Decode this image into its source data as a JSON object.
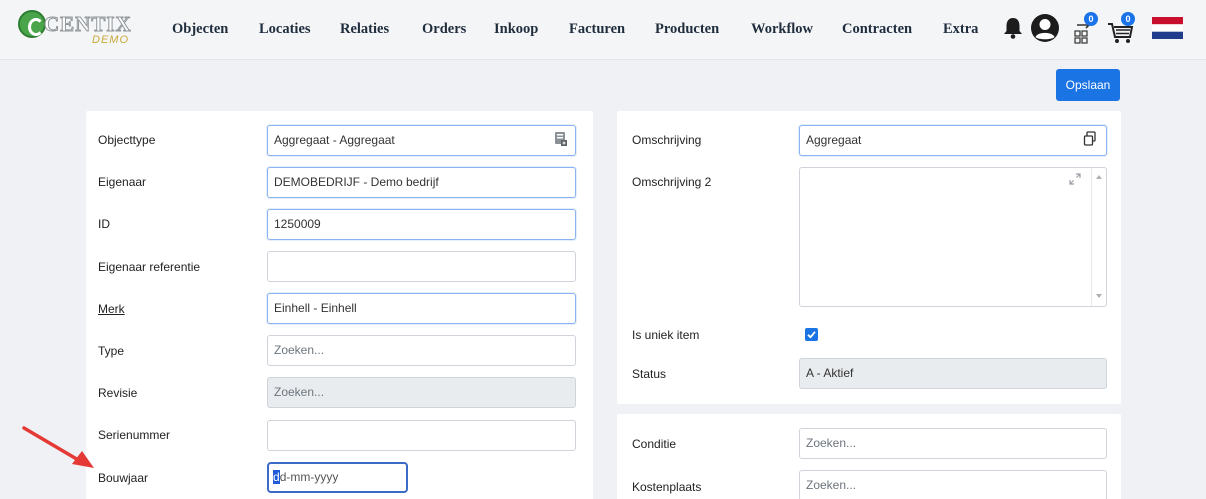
{
  "app": {
    "logo_text": "CENTIX",
    "logo_sub": "DEMO"
  },
  "nav": {
    "items": [
      "Objecten",
      "Locaties",
      "Relaties",
      "Orders",
      "Inkoop",
      "Facturen",
      "Producten",
      "Workflow",
      "Contracten",
      "Extra"
    ],
    "scan_badge": "0",
    "cart_badge": "0"
  },
  "toolbar": {
    "save_label": "Opslaan"
  },
  "left": {
    "objecttype": {
      "label": "Objecttype",
      "value": "Aggregaat - Aggregaat"
    },
    "eigenaar": {
      "label": "Eigenaar",
      "value": "DEMOBEDRIJF - Demo bedrijf"
    },
    "id": {
      "label": "ID",
      "value": "1250009"
    },
    "eigenaar_ref": {
      "label": "Eigenaar referentie",
      "value": ""
    },
    "merk": {
      "label": "Merk",
      "value": "Einhell - Einhell"
    },
    "type": {
      "label": "Type",
      "placeholder": "Zoeken..."
    },
    "revisie": {
      "label": "Revisie",
      "placeholder": "Zoeken..."
    },
    "serienummer": {
      "label": "Serienummer",
      "value": ""
    },
    "bouwjaar": {
      "label": "Bouwjaar",
      "placeholder_first": "d",
      "placeholder_rest": "d-mm-yyyy"
    }
  },
  "right": {
    "omschrijving": {
      "label": "Omschrijving",
      "value": "Aggregaat"
    },
    "omschrijving2": {
      "label": "Omschrijving 2",
      "value": ""
    },
    "uniek": {
      "label": "Is uniek item",
      "checked": true
    },
    "status": {
      "label": "Status",
      "value": "A - Aktief"
    }
  },
  "right2": {
    "conditie": {
      "label": "Conditie",
      "placeholder": "Zoeken..."
    },
    "kostenplaats": {
      "label": "Kostenplaats",
      "placeholder": "Zoeken..."
    }
  },
  "colors": {
    "accent": "#1b74e4",
    "arrow": "#e53935"
  }
}
